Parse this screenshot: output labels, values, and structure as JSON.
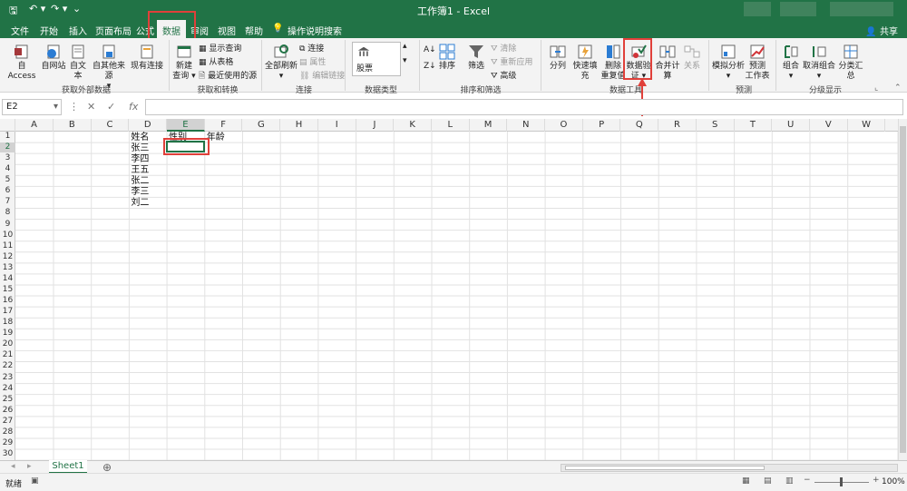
{
  "window": {
    "title": "工作簿1 - Excel"
  },
  "tabs": [
    {
      "label": "文件",
      "active": false
    },
    {
      "label": "开始",
      "active": false
    },
    {
      "label": "插入",
      "active": false
    },
    {
      "label": "页面布局",
      "active": false
    },
    {
      "label": "公式",
      "active": false
    },
    {
      "label": "数据",
      "active": true
    },
    {
      "label": "审阅",
      "active": false
    },
    {
      "label": "视图",
      "active": false
    },
    {
      "label": "帮助",
      "active": false
    }
  ],
  "tellme": "操作说明搜索",
  "share": "共享",
  "ribbon": {
    "external": {
      "access": "自 Access",
      "web": "自网站",
      "text": "自文本",
      "other_line1": "自其他来源",
      "other_line2": "▾",
      "existing": "现有连接",
      "group": "获取外部数据"
    },
    "transform": {
      "new_query_line1": "新建",
      "new_query_line2": "查询 ▾",
      "show_queries": "显示查询",
      "from_table": "从表格",
      "recent": "最近使用的源",
      "group": "获取和转换"
    },
    "connections": {
      "refresh_all_line1": "全部刷新",
      "refresh_all_line2": "▾",
      "connections": "连接",
      "properties": "属性",
      "edit_links": "编辑链接",
      "group": "连接"
    },
    "datatypes": {
      "stocks": "股票",
      "group": "数据类型"
    },
    "sortfilter": {
      "sort": "排序",
      "filter": "筛选",
      "clear": "清除",
      "reapply": "重新应用",
      "advanced": "高级",
      "group": "排序和筛选"
    },
    "datatools": {
      "text_to_columns": "分列",
      "flash_fill": "快速填充",
      "remove_dup_line1": "删除",
      "remove_dup_line2": "重复值",
      "validation_line1": "数据验",
      "validation_line2": "证 ▾",
      "consolidate": "合并计算",
      "relationships": "关系",
      "group": "数据工具"
    },
    "forecast": {
      "whatif_line1": "模拟分析",
      "whatif_line2": "▾",
      "sheet_line1": "预测",
      "sheet_line2": "工作表",
      "group": "预测"
    },
    "outline": {
      "group_btn_line1": "组合",
      "group_btn_line2": "▾",
      "ungroup_line1": "取消组合",
      "ungroup_line2": "▾",
      "subtotal": "分类汇总",
      "group": "分级显示"
    }
  },
  "formula_bar": {
    "name_box": "E2",
    "fx": "fx",
    "value": ""
  },
  "columns": [
    "A",
    "B",
    "C",
    "D",
    "E",
    "F",
    "G",
    "H",
    "I",
    "J",
    "K",
    "L",
    "M",
    "N",
    "O",
    "P",
    "Q",
    "R",
    "S",
    "T",
    "U",
    "V",
    "W"
  ],
  "rows": [
    "1",
    "2",
    "3",
    "4",
    "5",
    "6",
    "7",
    "8",
    "9",
    "10",
    "11",
    "12",
    "13",
    "14",
    "15",
    "16",
    "17",
    "18",
    "19",
    "20",
    "21",
    "22",
    "23",
    "24",
    "25",
    "26",
    "27",
    "28",
    "29",
    "30"
  ],
  "selected": {
    "column": "E",
    "row": "2"
  },
  "cells": {
    "D1": "姓名",
    "E1": "性别",
    "F1": "年龄",
    "D2": "张三",
    "D3": "李四",
    "D4": "王五",
    "D5": "张二",
    "D6": "李三",
    "D7": "刘二"
  },
  "sheets": [
    {
      "name": "Sheet1",
      "active": true
    }
  ],
  "status": {
    "ready": "就绪",
    "zoom": "100%"
  },
  "colors": {
    "brand": "#217346",
    "highlight": "#e0403a"
  }
}
